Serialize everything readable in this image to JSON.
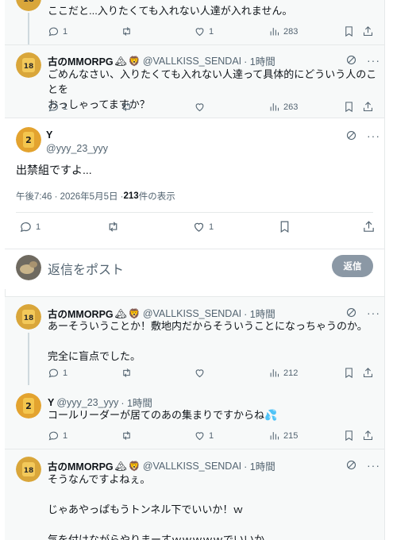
{
  "tweets": [
    {
      "text": "ここだと...入りたくても入れない人達が入れません。",
      "stats": {
        "replies": "1",
        "retweets": "",
        "likes": "1",
        "views": "283"
      }
    },
    {
      "name": "古のMMORPG",
      "handle": "@VALLKISS_SENDAI",
      "time": "· 1時間",
      "text": "ごめんなさい、入りたくても入れない人達って具体的にどういう人のことを\nおっしゃってますか？",
      "stats": {
        "replies": "1",
        "retweets": "",
        "likes": "",
        "views": "263"
      }
    },
    {
      "name": "Y",
      "handle": "@yyy_23_yyy",
      "text": "出禁組ですよ...",
      "meta_time": "午後7:46 · 2026年5月5日 · ",
      "meta_views": "213",
      "meta_views_label": " 件の表示",
      "stats": {
        "replies": "1",
        "retweets": "",
        "likes": "1"
      }
    },
    {
      "name": "古のMMORPG",
      "handle": "@VALLKISS_SENDAI",
      "time": "· 1時間",
      "text": "あーそういうことか！敷地内だからそういうことになっちゃうのか。\n\n完全に盲点でした。",
      "stats": {
        "replies": "1",
        "retweets": "",
        "likes": "",
        "views": "212"
      }
    },
    {
      "name": "Y",
      "handle": "@yyy_23_yyy",
      "time": "· 1時間",
      "text": "コールリーダーが居てのあの集まりですからね💦",
      "stats": {
        "replies": "1",
        "retweets": "",
        "likes": "1",
        "views": "215"
      }
    },
    {
      "name": "古のMMORPG",
      "handle": "@VALLKISS_SENDAI",
      "time": "· 1時間",
      "text": "そうなんですよねぇ。\n\nじゃあやっぱもうトンネル下でいいか！ｗ\n\n気を付けながらやりまーすｗｗｗｗｗでいいか。"
    }
  ],
  "reply": {
    "placeholder": "返信をポスト",
    "button": "返信"
  },
  "colors": {
    "text": "#0f1419",
    "secondary": "#536471",
    "border": "#e6e9ea",
    "reply_button": "#8b98a5"
  }
}
